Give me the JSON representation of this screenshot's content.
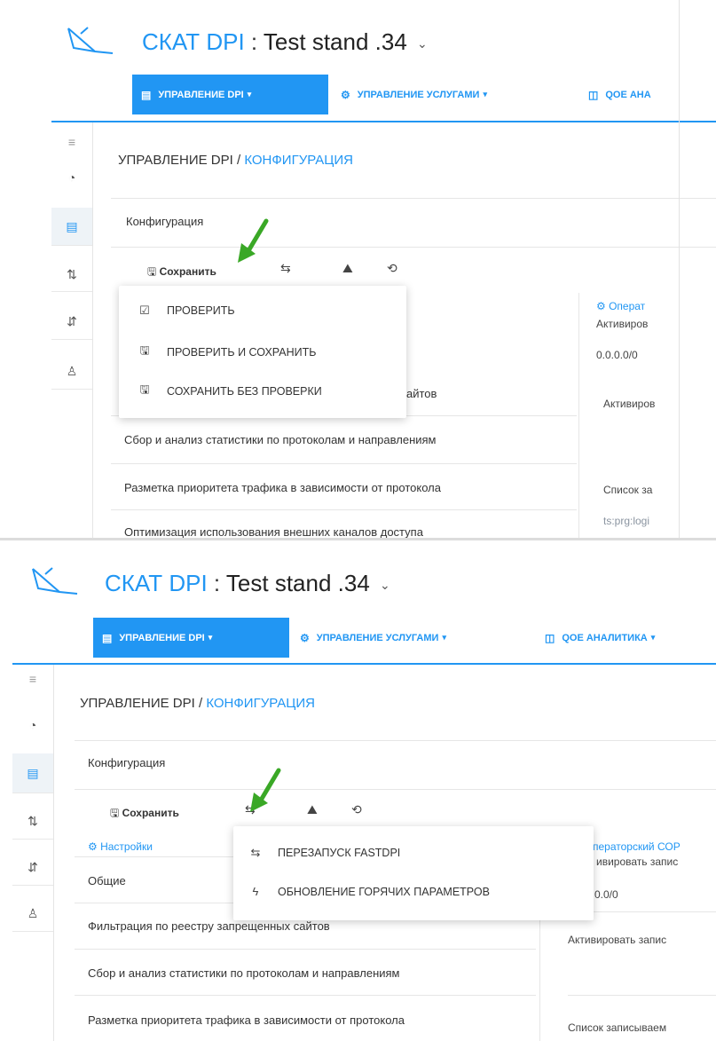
{
  "brand": {
    "name": "СКАТ DPI",
    "separator": ":",
    "stand": "Test stand .34",
    "chevron": "⌄"
  },
  "nav": {
    "active_label": "УПРАВЛЕНИЕ DPI",
    "services_label": "УПРАВЛЕНИЕ УСЛУГАМИ",
    "qoe_label_clipped": "QOE АНА",
    "qoe_label": "QOE АНАЛИТИКА",
    "caret": "▾"
  },
  "breadcrumb": {
    "root": "УПРАВЛЕНИЕ DPI",
    "sep": "/",
    "current": "КОНФИГУРАЦИЯ"
  },
  "config_title": "Конфигурация",
  "toolbar": {
    "save_label": "Сохранить"
  },
  "menu_save": [
    {
      "icon": "☑",
      "label": "ПРОВЕРИТЬ"
    },
    {
      "icon": "🖫",
      "label": "ПРОВЕРИТЬ И СОХРАНИТЬ"
    },
    {
      "icon": "🖫",
      "label": "СОХРАНИТЬ БЕЗ ПРОВЕРКИ"
    }
  ],
  "menu_restart": [
    {
      "icon": "⇆",
      "label": "ПЕРЕЗАПУСК FASTDPI"
    },
    {
      "icon": "ϟ",
      "label": "ОБНОВЛЕНИЕ ГОРЯЧИХ ПАРАМЕТРОВ"
    }
  ],
  "settings": {
    "header": "Настройки",
    "rows": [
      "Общие",
      "Фильтрация по реестру запрещенных сайтов",
      "Сбор и анализ статистики по протоколам и направлениям",
      "Разметка приоритета трафика в зависимости от протокола",
      "Оптимизация использования внешних каналов доступа"
    ],
    "row_clip_top": "айтов"
  },
  "right_top": {
    "header": "Операт",
    "line1": "Активиров",
    "line2": "0.0.0.0/0",
    "line3": "Активиров",
    "line4": "Список за",
    "line5": "ts:prg:logi"
  },
  "right_bottom": {
    "header": "ператорский СОР",
    "line1": "ивировать запис",
    "line2": "0.0/0",
    "line3": "Активировать запис",
    "line4": "Список записываем"
  },
  "colors": {
    "accent": "#2196f3",
    "arrow": "#3aa826"
  },
  "icons": {
    "logo": "bird-logo-icon",
    "menu": "hamburger-icon",
    "dashboard": "gauge-icon",
    "config": "list-icon",
    "sort1": "sort-icon",
    "sort2": "sort-icon",
    "user": "user-icon",
    "restart": "restart-icon",
    "upload": "cloud-upload-icon",
    "history": "history-icon",
    "gears": "gears-icon"
  }
}
